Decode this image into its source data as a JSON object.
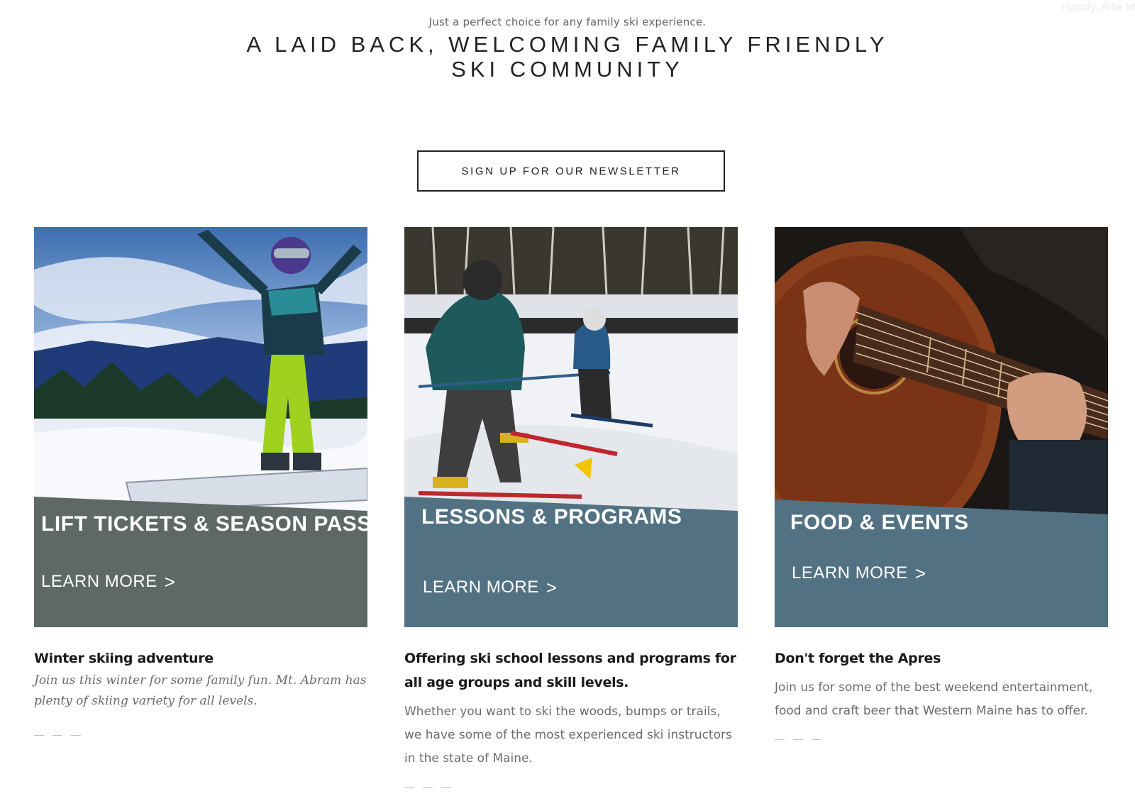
{
  "top_bar": {
    "greeting": "Howdy, Allie M"
  },
  "intro": {
    "tagline": "Just a perfect choice for any family ski experience.",
    "headline": "A LAID BACK, WELCOMING FAMILY FRIENDLY SKI COMMUNITY"
  },
  "newsletter": {
    "label": "SIGN UP FOR OUR NEWSLETTER"
  },
  "cards": [
    {
      "title": "LIFT TICKETS & SEASON PASSES",
      "link": "LEARN MORE",
      "arrow": ">",
      "band_color": "#5e6866"
    },
    {
      "title": "LESSONS & PROGRAMS",
      "link": "LEARN MORE",
      "arrow": ">",
      "band_color": "#527183"
    },
    {
      "title": "FOOD & EVENTS",
      "link": "LEARN MORE",
      "arrow": ">",
      "band_color": "#527183"
    }
  ],
  "columns": [
    {
      "heading": "Winter skiing adventure",
      "body": "Join us this winter for some family fun. Mt. Abram has plenty of skiing variety for all levels.",
      "divider": "— — —"
    },
    {
      "heading": "Offering ski school lessons and programs for all age groups and skill levels.",
      "body": "Whether you want to ski the woods, bumps or trails, we have some of the most experienced ski instructors in the state of Maine.",
      "divider": "— — —"
    },
    {
      "heading": "Don't forget the Apres",
      "body": "Join us for some of the best weekend entertainment, food and craft beer that Western Maine has to offer.",
      "divider": "— — —"
    }
  ]
}
